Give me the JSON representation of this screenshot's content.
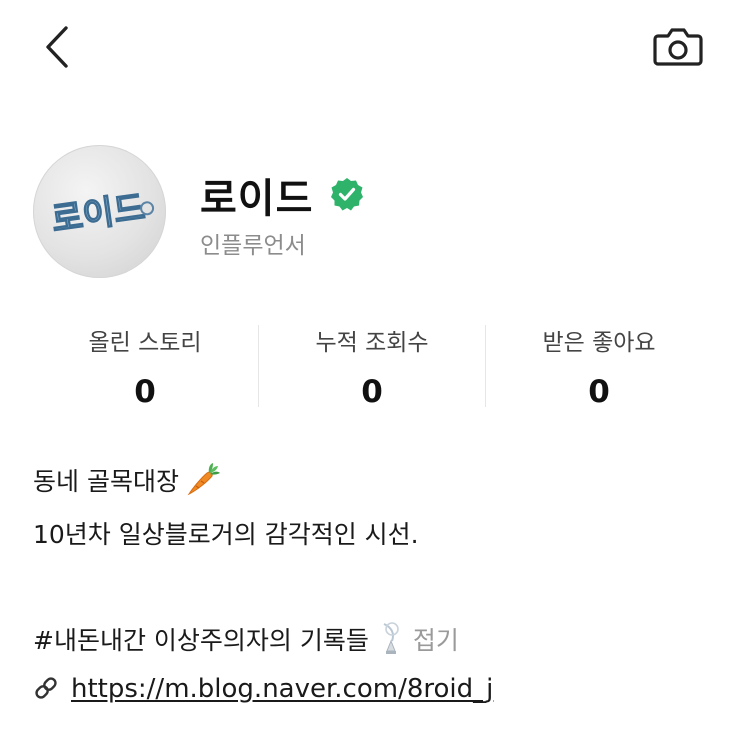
{
  "header": {
    "back_icon": "chevron-left-icon",
    "camera_icon": "camera-icon"
  },
  "profile": {
    "name": "로이드",
    "verified_icon": "verified-check-icon",
    "verified_color": "#2fb36b",
    "role": "인플루언서",
    "avatar_text": "로이드"
  },
  "stats": [
    {
      "label": "올린 스토리",
      "value": "0"
    },
    {
      "label": "누적 조회수",
      "value": "0"
    },
    {
      "label": "받은 좋아요",
      "value": "0"
    }
  ],
  "bio": {
    "line1": "동네 골목대장",
    "line1_icon": "carrot-icon",
    "line2": "10년차 일상블로거의 감각적인 시선.",
    "hashtag": "#내돈내간 이상주의자의 기록들",
    "hashtag_icon": "antenna-icon",
    "fold_label": "접기",
    "link_icon": "link-icon",
    "link_url": "https://m.blog.naver.com/8roid_j"
  }
}
